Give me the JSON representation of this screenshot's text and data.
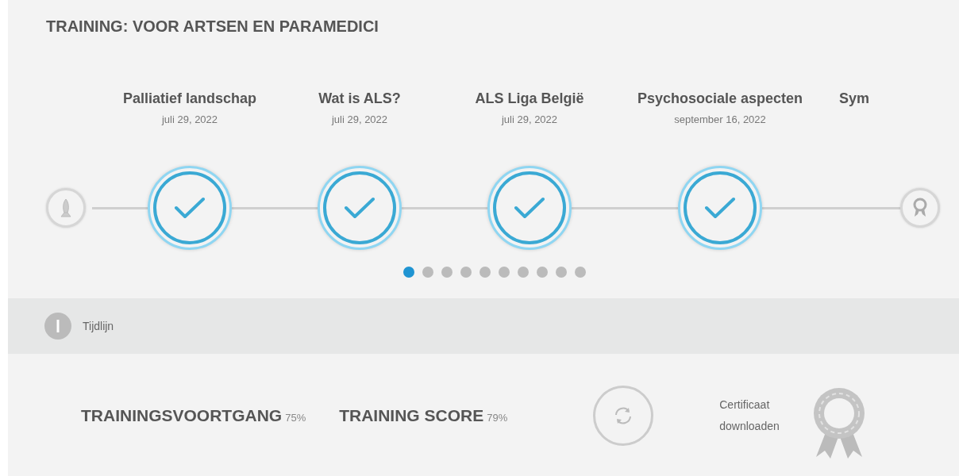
{
  "title": "TRAINING: VOOR ARTSEN EN PARAMEDICI",
  "timeline": {
    "steps": [
      {
        "kind": "step",
        "title": "Palliatief landschap",
        "date": "juli 29, 2022",
        "completed": true
      },
      {
        "kind": "step",
        "title": "Wat is ALS?",
        "date": "juli 29, 2022",
        "completed": true
      },
      {
        "kind": "step",
        "title": "ALS Liga België",
        "date": "juli 29, 2022",
        "completed": true
      },
      {
        "kind": "step",
        "title": "Psychosociale aspecten",
        "date": "september 16, 2022",
        "completed": true
      },
      {
        "kind": "cut",
        "title": "Sym"
      }
    ],
    "pages": [
      {
        "selected": true
      },
      {
        "selected": false
      },
      {
        "selected": false
      },
      {
        "selected": false
      },
      {
        "selected": false
      },
      {
        "selected": false
      },
      {
        "selected": false
      },
      {
        "selected": false
      },
      {
        "selected": false
      },
      {
        "selected": false
      }
    ]
  },
  "info_bar": {
    "label": "Tijdlijn"
  },
  "stats": [
    {
      "label": "TRAININGSVOORTGANG",
      "value": "75%"
    },
    {
      "label": "TRAINING SCORE",
      "value": "79%"
    }
  ],
  "certificate": {
    "label": "Certificaat downloaden"
  }
}
